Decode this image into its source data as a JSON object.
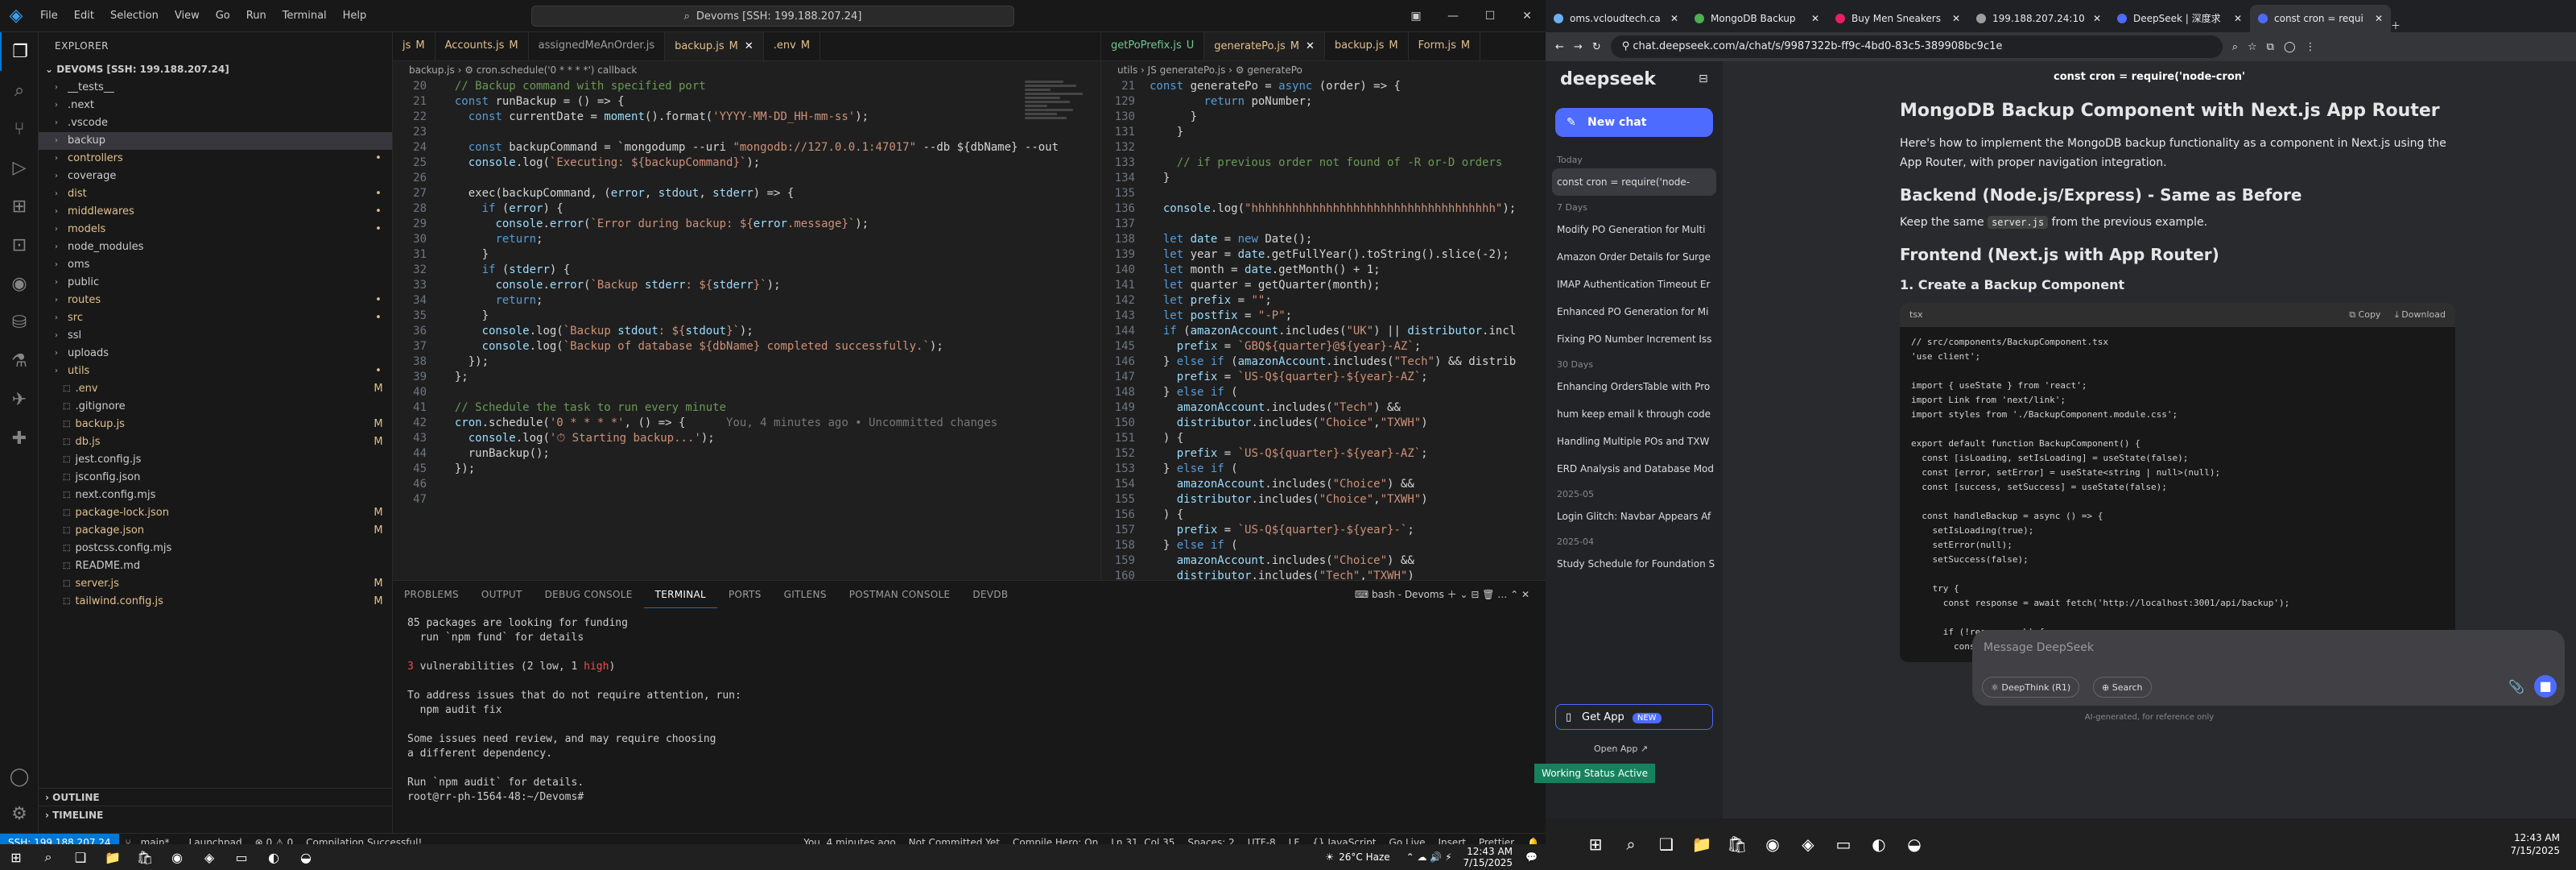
{
  "vscode": {
    "window_title": "Devoms [SSH: 199.188.207.24]",
    "menu": [
      "File",
      "Edit",
      "Selection",
      "View",
      "Go",
      "Run",
      "Terminal",
      "Help"
    ],
    "explorer_header": "EXPLORER",
    "root_folder": "DEVOMS [SSH: 199.188.207.24]",
    "tree": [
      {
        "name": "__tests__",
        "type": "folder",
        "badge": ""
      },
      {
        "name": ".next",
        "type": "folder",
        "badge": ""
      },
      {
        "name": ".vscode",
        "type": "folder",
        "badge": ""
      },
      {
        "name": "backup",
        "type": "folder",
        "badge": "",
        "selected": true
      },
      {
        "name": "controllers",
        "type": "folder",
        "badge": "•"
      },
      {
        "name": "coverage",
        "type": "folder",
        "badge": ""
      },
      {
        "name": "dist",
        "type": "folder",
        "badge": "•"
      },
      {
        "name": "middlewares",
        "type": "folder",
        "badge": "•"
      },
      {
        "name": "models",
        "type": "folder",
        "badge": "•"
      },
      {
        "name": "node_modules",
        "type": "folder",
        "badge": ""
      },
      {
        "name": "oms",
        "type": "folder",
        "badge": ""
      },
      {
        "name": "public",
        "type": "folder",
        "badge": ""
      },
      {
        "name": "routes",
        "type": "folder",
        "badge": "•"
      },
      {
        "name": "src",
        "type": "folder",
        "badge": "•"
      },
      {
        "name": "ssl",
        "type": "folder",
        "badge": ""
      },
      {
        "name": "uploads",
        "type": "folder",
        "badge": ""
      },
      {
        "name": "utils",
        "type": "folder",
        "badge": "•"
      },
      {
        "name": ".env",
        "type": "file",
        "badge": "M"
      },
      {
        "name": ".gitignore",
        "type": "file",
        "badge": ""
      },
      {
        "name": "backup.js",
        "type": "file",
        "badge": "M"
      },
      {
        "name": "db.js",
        "type": "file",
        "badge": "M"
      },
      {
        "name": "jest.config.js",
        "type": "file",
        "badge": ""
      },
      {
        "name": "jsconfig.json",
        "type": "file",
        "badge": ""
      },
      {
        "name": "next.config.mjs",
        "type": "file",
        "badge": ""
      },
      {
        "name": "package-lock.json",
        "type": "file",
        "badge": "M"
      },
      {
        "name": "package.json",
        "type": "file",
        "badge": "M"
      },
      {
        "name": "postcss.config.mjs",
        "type": "file",
        "badge": ""
      },
      {
        "name": "README.md",
        "type": "file",
        "badge": ""
      },
      {
        "name": "server.js",
        "type": "file",
        "badge": "M"
      },
      {
        "name": "tailwind.config.js",
        "type": "file",
        "badge": "M"
      }
    ],
    "outline_label": "OUTLINE",
    "timeline_label": "TIMELINE",
    "left_tabs": [
      {
        "label": "js",
        "flag": "M"
      },
      {
        "label": "Accounts.js",
        "flag": "M"
      },
      {
        "label": "assignedMeAnOrder.js",
        "flag": ""
      },
      {
        "label": "backup.js",
        "flag": "M",
        "active": true
      },
      {
        "label": ".env",
        "flag": "M"
      }
    ],
    "left_breadcrumb": "backup.js › ⚙ cron.schedule('0 * * * *') callback",
    "left_code": [
      {
        "n": "20",
        "t": "  // Backup command with specified port"
      },
      {
        "n": "21",
        "t": "  const runBackup = () => {"
      },
      {
        "n": "22",
        "t": "    const currentDate = moment().format('YYYY-MM-DD_HH-mm-ss');"
      },
      {
        "n": "23",
        "t": ""
      },
      {
        "n": "24",
        "t": "    const backupCommand = `mongodump --uri \"mongodb://127.0.0.1:47017\" --db ${dbName} --out"
      },
      {
        "n": "25",
        "t": "    console.log(`Executing: ${backupCommand}`);"
      },
      {
        "n": "26",
        "t": ""
      },
      {
        "n": "27",
        "t": "    exec(backupCommand, (error, stdout, stderr) => {"
      },
      {
        "n": "28",
        "t": "      if (error) {"
      },
      {
        "n": "29",
        "t": "        console.error(`Error during backup: ${error.message}`);"
      },
      {
        "n": "30",
        "t": "        return;"
      },
      {
        "n": "31",
        "t": "      }"
      },
      {
        "n": "32",
        "t": "      if (stderr) {"
      },
      {
        "n": "33",
        "t": "        console.error(`Backup stderr: ${stderr}`);"
      },
      {
        "n": "34",
        "t": "        return;"
      },
      {
        "n": "35",
        "t": "      }"
      },
      {
        "n": "36",
        "t": "      console.log(`Backup stdout: ${stdout}`);"
      },
      {
        "n": "37",
        "t": "      console.log(`Backup of database ${dbName} completed successfully.`);"
      },
      {
        "n": "38",
        "t": "    });"
      },
      {
        "n": "39",
        "t": "  };"
      },
      {
        "n": "40",
        "t": ""
      },
      {
        "n": "41",
        "t": "  // Schedule the task to run every minute"
      },
      {
        "n": "42",
        "t": "  cron.schedule('0 * * * *', () => {      You, 4 minutes ago • Uncommitted changes"
      },
      {
        "n": "43",
        "t": "    console.log('⏱ Starting backup...');"
      },
      {
        "n": "44",
        "t": "    runBackup();"
      },
      {
        "n": "45",
        "t": "  });"
      },
      {
        "n": "46",
        "t": ""
      },
      {
        "n": "47",
        "t": ""
      }
    ],
    "right_tabs": [
      {
        "label": "getPoPrefix.js",
        "flag": "U"
      },
      {
        "label": "generatePo.js",
        "flag": "M",
        "active": true
      },
      {
        "label": "backup.js",
        "flag": "M"
      },
      {
        "label": "Form.js",
        "flag": "M"
      }
    ],
    "right_breadcrumb": "utils › JS generatePo.js › ⚙ generatePo",
    "right_code": [
      {
        "n": "21",
        "t": "const generatePo = async (order) => {"
      },
      {
        "n": "129",
        "t": "        return poNumber;"
      },
      {
        "n": "130",
        "t": "      }"
      },
      {
        "n": "131",
        "t": "    }"
      },
      {
        "n": "132",
        "t": ""
      },
      {
        "n": "133",
        "t": "    // if previous order not found of -R or-D orders"
      },
      {
        "n": "134",
        "t": "  }"
      },
      {
        "n": "135",
        "t": ""
      },
      {
        "n": "136",
        "t": "  console.log(\"hhhhhhhhhhhhhhhhhhhhhhhhhhhhhhhhhhhh\");"
      },
      {
        "n": "137",
        "t": ""
      },
      {
        "n": "138",
        "t": "  let date = new Date();"
      },
      {
        "n": "139",
        "t": "  let year = date.getFullYear().toString().slice(-2);"
      },
      {
        "n": "140",
        "t": "  let month = date.getMonth() + 1;"
      },
      {
        "n": "141",
        "t": "  let quarter = getQuarter(month);"
      },
      {
        "n": "142",
        "t": "  let prefix = \"\";"
      },
      {
        "n": "143",
        "t": "  let postfix = \"-P\";"
      },
      {
        "n": "144",
        "t": "  if (amazonAccount.includes(\"UK\") || distributor.incl"
      },
      {
        "n": "145",
        "t": "    prefix = `GBQ${quarter}@${year}-AZ`;"
      },
      {
        "n": "146",
        "t": "  } else if (amazonAccount.includes(\"Tech\") && distrib"
      },
      {
        "n": "147",
        "t": "    prefix = `US-Q${quarter}-${year}-AZ`;"
      },
      {
        "n": "148",
        "t": "  } else if ("
      },
      {
        "n": "149",
        "t": "    amazonAccount.includes(\"Tech\") &&"
      },
      {
        "n": "150",
        "t": "    distributor.includes(\"Choice\",\"TXWH\")"
      },
      {
        "n": "151",
        "t": "  ) {"
      },
      {
        "n": "152",
        "t": "    prefix = `US-Q${quarter}-${year}-AZ`;"
      },
      {
        "n": "153",
        "t": "  } else if ("
      },
      {
        "n": "154",
        "t": "    amazonAccount.includes(\"Choice\") &&"
      },
      {
        "n": "155",
        "t": "    distributor.includes(\"Choice\",\"TXWH\")"
      },
      {
        "n": "156",
        "t": "  ) {"
      },
      {
        "n": "157",
        "t": "    prefix = `US-Q${quarter}-${year}-`;"
      },
      {
        "n": "158",
        "t": "  } else if ("
      },
      {
        "n": "159",
        "t": "    amazonAccount.includes(\"Choice\") &&"
      },
      {
        "n": "160",
        "t": "    distributor.includes(\"Tech\",\"TXWH\")"
      }
    ],
    "panel_tabs": [
      "PROBLEMS",
      "OUTPUT",
      "DEBUG CONSOLE",
      "TERMINAL",
      "PORTS",
      "GITLENS",
      "POSTMAN CONSOLE",
      "DEVDB"
    ],
    "terminal_shell": "bash - Devoms",
    "terminal_lines": [
      "85 packages are looking for funding",
      "  run `npm fund` for details",
      "",
      "3 vulnerabilities (2 low, 1 high)",
      "",
      "To address issues that do not require attention, run:",
      "  npm audit fix",
      "",
      "Some issues need review, and may require choosing",
      "a different dependency.",
      "",
      "Run `npm audit` for details.",
      "root@rr-ph-1564-48:~/Devoms# "
    ],
    "status": {
      "remote": "SSH: 199.188.207.24",
      "branch": "main*",
      "launchpad": "Launchpad",
      "errors": "⊗ 0 ⚠ 0",
      "compile": "Compilation Successful!",
      "blame": "You, 4 minutes ago",
      "commit": "Not Committed Yet",
      "compile_hero": "Compile Hero: On",
      "position": "Ln 31, Col 35",
      "spaces": "Spaces: 2",
      "encoding": "UTF-8",
      "eol": "LF",
      "language": "{} JavaScript",
      "golive": "Go Live",
      "insert": "Insert",
      "prettier": "Prettier"
    },
    "weather": "26°C  Haze",
    "clock_left_time": "12:43 AM",
    "clock_left_date": "7/15/2025"
  },
  "browser": {
    "tabs": [
      {
        "label": "oms.vcloudtech.ca",
        "color": "#6ab0f3"
      },
      {
        "label": "MongoDB Backup",
        "color": "#4caf50"
      },
      {
        "label": "Buy Men Sneakers",
        "color": "#e91e63"
      },
      {
        "label": "199.188.207.24:10",
        "color": "#9e9e9e"
      },
      {
        "label": "DeepSeek | 深度求",
        "color": "#4d6bfe"
      },
      {
        "label": "const cron = requi",
        "color": "#4d6bfe",
        "active": true
      }
    ],
    "url": "chat.deepseek.com/a/chat/s/9987322b-ff9c-4bd0-83c5-389908bc9c1e",
    "deepseek": {
      "logo": "deepseek",
      "new_chat": "New chat",
      "conversation_title": "const cron = require('node-cron'",
      "groups": [
        {
          "label": "Today",
          "items": [
            "const cron = require('node-"
          ]
        },
        {
          "label": "7 Days",
          "items": [
            "Modify PO Generation for Multi",
            "Amazon Order Details for Surge",
            "IMAP Authentication Timeout Er",
            "Enhanced PO Generation for Mi",
            "Fixing PO Number Increment Iss"
          ]
        },
        {
          "label": "30 Days",
          "items": [
            "Enhancing OrdersTable with Pro",
            "hum keep email k through code",
            "Handling Multiple POs and TXW",
            "ERD Analysis and Database Mod"
          ]
        },
        {
          "label": "2025-05",
          "items": [
            "Login Glitch: Navbar Appears Af"
          ]
        },
        {
          "label": "2025-04",
          "items": [
            "Study Schedule for Foundation S"
          ]
        }
      ],
      "get_app": "Get App",
      "new_badge": "NEW",
      "open_app": "Open App ↗",
      "h1": "MongoDB Backup Component with Next.js App Router",
      "intro": "Here's how to implement the MongoDB backup functionality as a component in Next.js using the App Router, with proper navigation integration.",
      "h2a": "Backend (Node.js/Express) - Same as Before",
      "keep_pre": "Keep the same",
      "keep_code": "server.js",
      "keep_post": "from the previous example.",
      "h2b": "Frontend (Next.js with App Router)",
      "h3": "1. Create a Backup Component",
      "code_lang": "tsx",
      "copy": "⧉ Copy",
      "download": "⤓ Download",
      "code": "// src/components/BackupComponent.tsx\n'use client';\n\nimport { useState } from 'react';\nimport Link from 'next/link';\nimport styles from './BackupComponent.module.css';\n\nexport default function BackupComponent() {\n  const [isLoading, setIsLoading] = useState(false);\n  const [error, setError] = useState<string | null>(null);\n  const [success, setSuccess] = useState(false);\n\n  const handleBackup = async () => {\n    setIsLoading(true);\n    setError(null);\n    setSuccess(false);\n\n    try {\n      const response = await fetch('http://localhost:3001/api/backup');\n\n      if (!response.ok) {\n        const errorData = await response.json();",
      "input_placeholder": "Message DeepSeek",
      "deepthink": "⚛ DeepThink (R1)",
      "search": "⊕ Search",
      "disclaimer": "AI-generated, for reference only"
    },
    "toast": "Working Status Active",
    "clock_right_time": "12:43 AM",
    "clock_right_date": "7/15/2025"
  }
}
